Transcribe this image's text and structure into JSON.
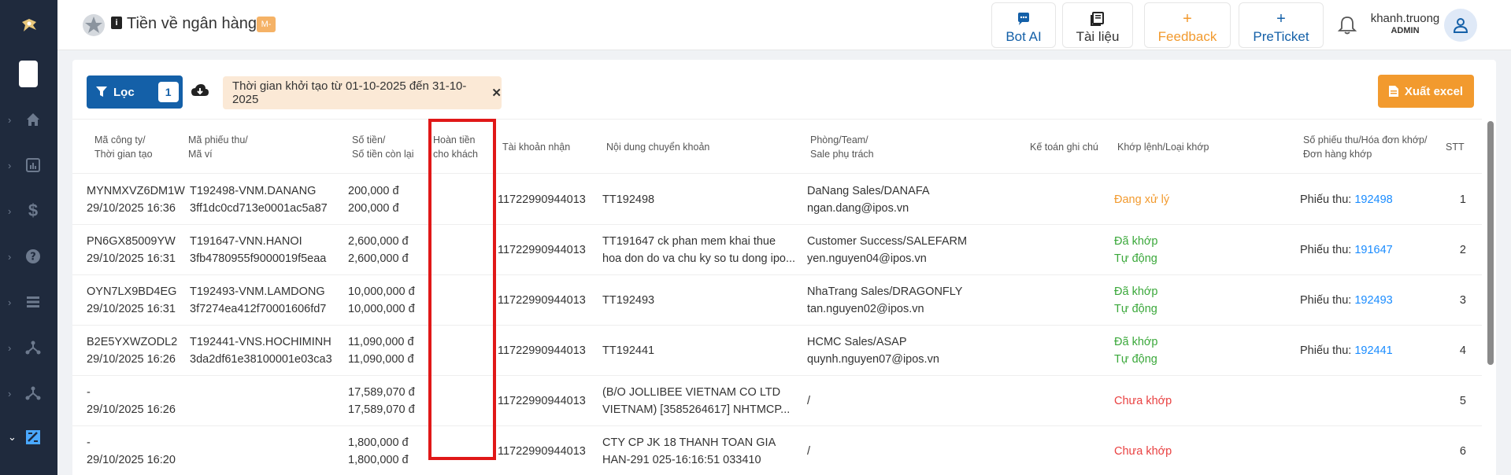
{
  "header": {
    "title": "Tiền về ngân hàng",
    "badge": "M-",
    "buttons": [
      {
        "label": "Bot AI",
        "icon": "chat-icon"
      },
      {
        "label": "Tài liệu",
        "icon": "book-icon"
      },
      {
        "label": "Feedback",
        "icon": "plus-icon"
      },
      {
        "label": "PreTicket",
        "icon": "plus-icon"
      }
    ],
    "user": {
      "name": "khanh.truong",
      "role": "ADMIN"
    }
  },
  "toolbar": {
    "filter_label": "Lọc",
    "filter_count": "1",
    "filter_chip": "Thời gian khởi tạo từ 01-10-2025 đến 31-10-2025",
    "export_label": "Xuất excel"
  },
  "columns": {
    "company_1": "Mã công ty/",
    "company_2": "Thời gian tạo",
    "receipt_1": "Mã phiếu thu/",
    "receipt_2": "Mã ví",
    "amount_1": "Số tiền/",
    "amount_2": "Số tiền còn lại",
    "refund_1": "Hoàn tiền",
    "refund_2": "cho khách",
    "account": "Tài khoản nhận",
    "content": "Nội dung chuyển khoản",
    "dept_1": "Phòng/Team/",
    "dept_2": "Sale phụ trách",
    "note": "Kế toán ghi chú",
    "match": "Khớp lệnh/Loại khớp",
    "invoice_1": "Số phiếu thu/Hóa đơn khớp/",
    "invoice_2": "Đơn hàng khớp",
    "stt": "STT"
  },
  "rows": [
    {
      "company": "MYNMXVZ6DM1W",
      "created": "29/10/2025 16:36",
      "receipt": "T192498-VNM.DANANG",
      "wallet": "3ff1dc0cd713e0001ac5a87",
      "amount": "200,000 đ",
      "remaining": "200,000 đ",
      "account": "11722990944013",
      "content_1": "TT192498",
      "content_2": "",
      "dept": "DaNang Sales/DANAFA",
      "sale": "ngan.dang@ipos.vn",
      "match_1": "Đang xử lý",
      "match_2": "",
      "match_state": "processing",
      "invoice_label": "Phiếu thu: ",
      "invoice_no": "192498",
      "stt": "1"
    },
    {
      "company": "PN6GX85009YW",
      "created": "29/10/2025 16:31",
      "receipt": "T191647-VNN.HANOI",
      "wallet": "3fb4780955f9000019f5eaa",
      "amount": "2,600,000 đ",
      "remaining": "2,600,000 đ",
      "account": "11722990944013",
      "content_1": "TT191647 ck phan mem khai thue",
      "content_2": "hoa don do va chu ky so tu dong ipo...",
      "dept": "Customer Success/SALEFARM",
      "sale": "yen.nguyen04@ipos.vn",
      "match_1": "Đã khớp",
      "match_2": "Tự động",
      "match_state": "done",
      "invoice_label": "Phiếu thu: ",
      "invoice_no": "191647",
      "stt": "2"
    },
    {
      "company": "OYN7LX9BD4EG",
      "created": "29/10/2025 16:31",
      "receipt": "T192493-VNM.LAMDONG",
      "wallet": "3f7274ea412f70001606fd7",
      "amount": "10,000,000 đ",
      "remaining": "10,000,000 đ",
      "account": "11722990944013",
      "content_1": "TT192493",
      "content_2": "",
      "dept": "NhaTrang Sales/DRAGONFLY",
      "sale": "tan.nguyen02@ipos.vn",
      "match_1": "Đã khớp",
      "match_2": "Tự động",
      "match_state": "done",
      "invoice_label": "Phiếu thu: ",
      "invoice_no": "192493",
      "stt": "3"
    },
    {
      "company": "B2E5YXWZODL2",
      "created": "29/10/2025 16:26",
      "receipt": "T192441-VNS.HOCHIMINH",
      "wallet": "3da2df61e38100001e03ca3",
      "amount": "11,090,000 đ",
      "remaining": "11,090,000 đ",
      "account": "11722990944013",
      "content_1": "TT192441",
      "content_2": "",
      "dept": "HCMC Sales/ASAP",
      "sale": "quynh.nguyen07@ipos.vn",
      "match_1": "Đã khớp",
      "match_2": "Tự động",
      "match_state": "done",
      "invoice_label": "Phiếu thu: ",
      "invoice_no": "192441",
      "stt": "4"
    },
    {
      "company": "-",
      "created": "29/10/2025 16:26",
      "receipt": "",
      "wallet": "",
      "amount": "17,589,070 đ",
      "remaining": "17,589,070 đ",
      "account": "11722990944013",
      "content_1": "(B/O JOLLIBEE VIETNAM CO LTD",
      "content_2": "VIETNAM) [3585264617] NHTMCP...",
      "dept": "/",
      "sale": "",
      "match_1": "Chưa khớp",
      "match_2": "",
      "match_state": "none",
      "invoice_label": "",
      "invoice_no": "",
      "stt": "5"
    },
    {
      "company": "-",
      "created": "29/10/2025 16:20",
      "receipt": "",
      "wallet": "",
      "amount": "1,800,000 đ",
      "remaining": "1,800,000 đ",
      "account": "11722990944013",
      "content_1": "CTY CP JK 18 THANH TOAN GIA",
      "content_2": "HAN-291 025-16:16:51 033410",
      "dept": "/",
      "sale": "",
      "match_1": "Chưa khớp",
      "match_2": "",
      "match_state": "none",
      "invoice_label": "",
      "invoice_no": "",
      "stt": "6"
    }
  ],
  "colors": {
    "primary": "#1460a8",
    "export": "#f29a2e",
    "highlight": "#e01818",
    "sidebar": "#1f2a3d"
  }
}
